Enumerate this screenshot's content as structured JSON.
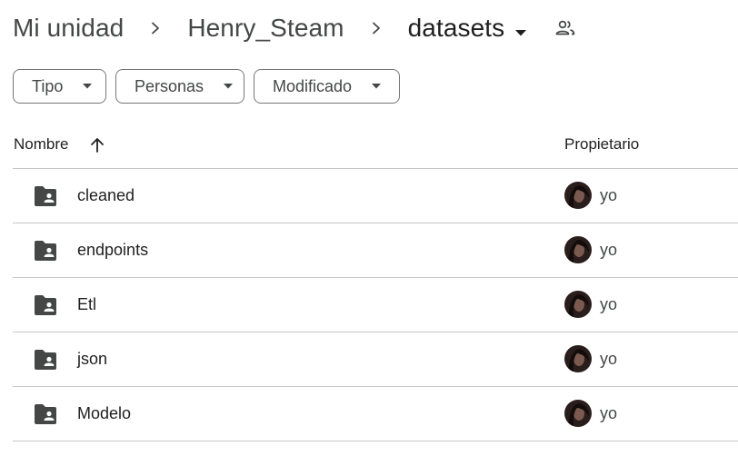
{
  "breadcrumb": {
    "items": [
      "Mi unidad",
      "Henry_Steam",
      "datasets"
    ]
  },
  "filters": {
    "tipo": "Tipo",
    "personas": "Personas",
    "modificado": "Modificado"
  },
  "table": {
    "columns": {
      "name": "Nombre",
      "owner": "Propietario"
    },
    "rows": [
      {
        "name": "cleaned",
        "owner": "yo"
      },
      {
        "name": "endpoints",
        "owner": "yo"
      },
      {
        "name": "Etl",
        "owner": "yo"
      },
      {
        "name": "json",
        "owner": "yo"
      },
      {
        "name": "Modelo",
        "owner": "yo"
      }
    ]
  },
  "icons": {
    "breadcrumb_separator": "chevron-right-icon",
    "folder_menu": "caret-down-icon",
    "shared": "people-icon",
    "sort": "arrow-up-icon",
    "row_type": "shared-folder-icon"
  },
  "colors": {
    "text_primary": "#1f1f1f",
    "text_secondary": "#444746",
    "folder": "#444746",
    "divider": "#c7c7c7",
    "chip_border": "#747775"
  }
}
